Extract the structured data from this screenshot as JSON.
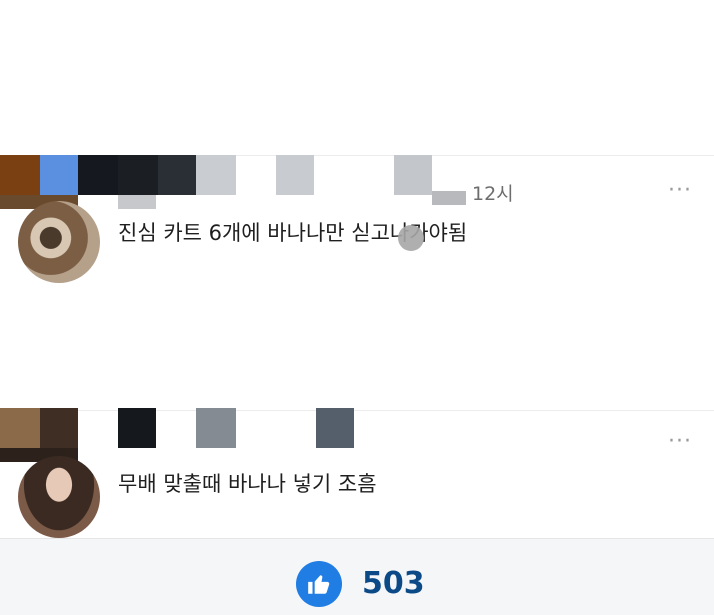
{
  "comments": [
    {
      "time": "12시",
      "more_label": "···",
      "text": "진심 카트 6개에 바나나만 싣고나가야됨"
    },
    {
      "more_label": "···",
      "text": "무배 맞출때 바나나 넣기 조흠"
    }
  ],
  "footer": {
    "like_count": "503"
  },
  "colors": {
    "like_blue": "#1f7de3",
    "count_blue": "#0b4a86"
  },
  "icons": {
    "like": "thumbs-up-icon",
    "more": "more-dots-icon"
  }
}
